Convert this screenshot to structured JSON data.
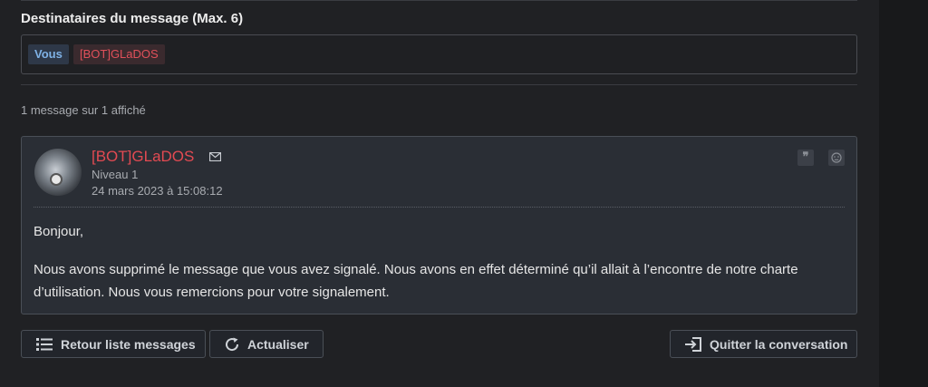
{
  "recipients": {
    "title": "Destinataires du message (Max. 6)",
    "chips": [
      "Vous",
      "[BOT]GLaDOS"
    ]
  },
  "pagination": {
    "count_text": "1 message sur 1 affiché"
  },
  "message": {
    "author": "[BOT]GLaDOS",
    "rank": "Niveau 1",
    "date": "24 mars 2023 à 15:08:12",
    "greeting": "Bonjour,",
    "body": "Nous avons supprimé le message que vous avez signalé. Nous avons en effet déterminé qu’il allait à l’encontre de notre charte d’utilisation. Nous vous remercions pour votre signalement.",
    "quote_icon": "quote-icon",
    "report_icon": "report-icon"
  },
  "actions": {
    "back_label": "Retour liste messages",
    "refresh_label": "Actualiser",
    "quit_label": "Quitter la conversation"
  },
  "colors": {
    "author": "#e34a52",
    "you_chip": "#7fb2e6",
    "background": "#202124",
    "panel": "#2a2e35"
  }
}
